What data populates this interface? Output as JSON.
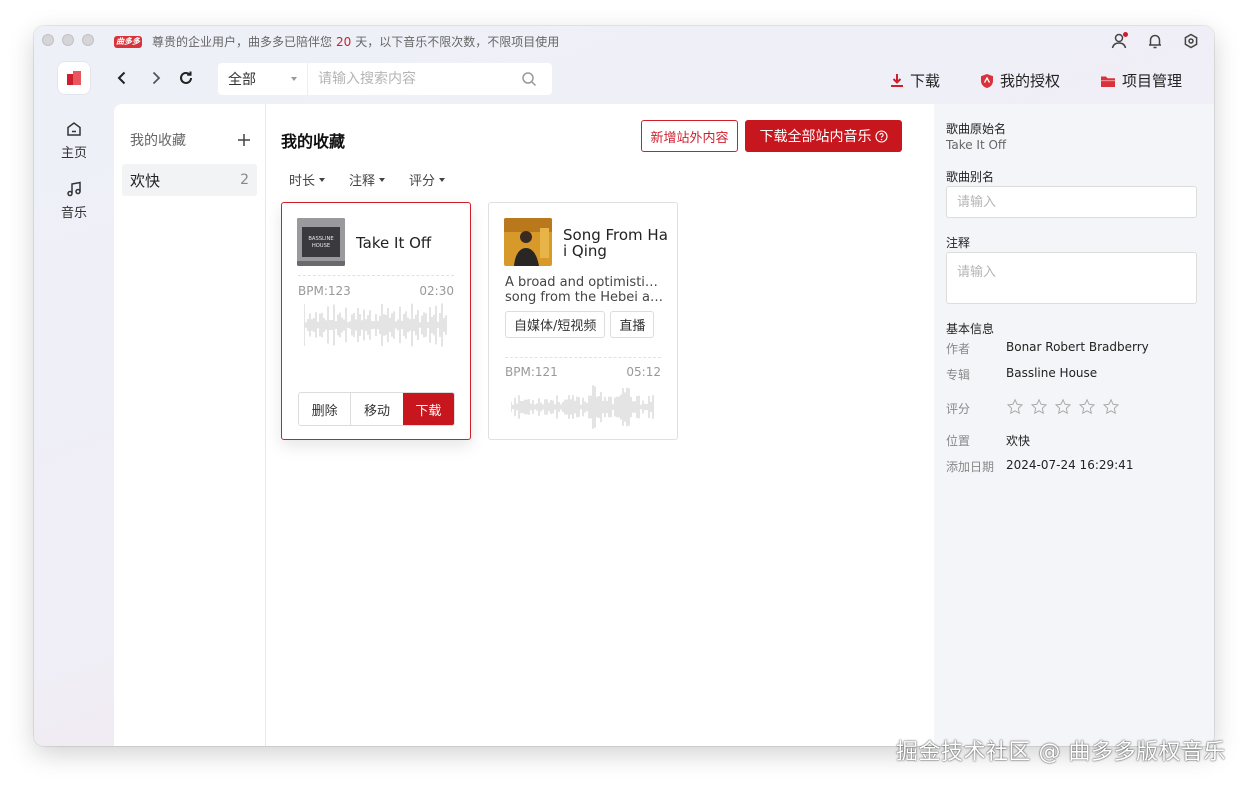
{
  "titlebar": {
    "notice_logo": "曲多多",
    "notice_prefix": "尊贵的企业用户，曲多多已陪伴您",
    "notice_days": "20",
    "notice_suffix": "天，以下音乐不限次数，不限项目使用"
  },
  "nav": {
    "search_scope": "全部",
    "search_placeholder": "请输入搜索内容",
    "actions": {
      "download": "下载",
      "license": "我的授权",
      "projects": "项目管理"
    }
  },
  "rail": [
    {
      "label": "主页",
      "icon": "home-icon"
    },
    {
      "label": "音乐",
      "icon": "music-note-icon"
    }
  ],
  "favorites": {
    "heading": "我的收藏",
    "items": [
      {
        "label": "欢快",
        "count": "2"
      }
    ]
  },
  "main": {
    "title": "我的收藏",
    "add_external_button": "新增站外内容",
    "download_all_button": "下载全部站内音乐",
    "filters": [
      "时长",
      "注释",
      "评分"
    ]
  },
  "cards": [
    {
      "title": "Take It Off",
      "cover_text": "BASSLINE HOUSE",
      "bpm": "BPM:123",
      "duration": "02:30",
      "actions": {
        "delete": "删除",
        "move": "移动",
        "download": "下载"
      }
    },
    {
      "title_line1": "Song From Ha",
      "title_line2": "i Qing",
      "desc_line1": "A broad and optimistic folk",
      "desc_line2": "song from the Hebei and...",
      "tags": [
        "自媒体/短视频",
        "直播"
      ],
      "bpm": "BPM:121",
      "duration": "05:12"
    }
  ],
  "detail": {
    "original_name_label": "歌曲原始名",
    "original_name_value": "Take It Off",
    "alias_label": "歌曲别名",
    "alias_placeholder": "请输入",
    "note_label": "注释",
    "note_placeholder": "请输入",
    "basic_info_label": "基本信息",
    "author_key": "作者",
    "author_value": "Bonar Robert Bradberry",
    "album_key": "专辑",
    "album_value": "Bassline House",
    "rating_key": "评分",
    "rating_value": 0,
    "rating_max": 5,
    "location_key": "位置",
    "location_value": "欢快",
    "added_key": "添加日期",
    "added_value": "2024-07-24 16:29:41"
  },
  "watermark": "掘金技术社区 @ 曲多多版权音乐",
  "colors": {
    "brand_red": "#c8161e",
    "accent_red": "#cf1f2d",
    "panel_bg": "#f4f5f8"
  }
}
